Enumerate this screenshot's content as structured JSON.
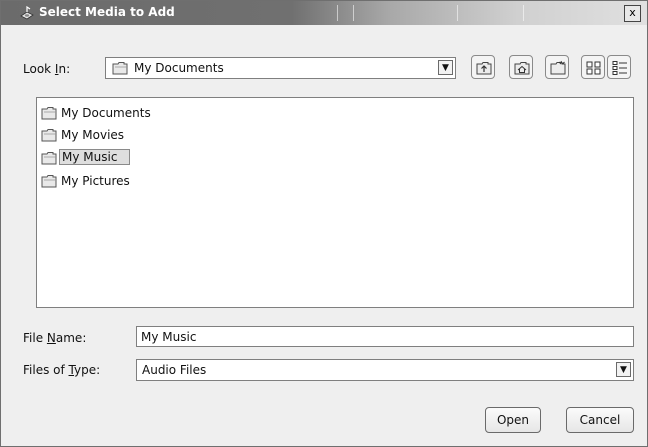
{
  "window": {
    "title": "Select Media to Add",
    "close_label": "x"
  },
  "look_in": {
    "label_prefix": "Look ",
    "label_mnemonic": "I",
    "label_suffix": "n:",
    "value": "My Documents"
  },
  "toolbar": {
    "buttons": [
      {
        "name": "up-one-level",
        "icon": "folder-up-icon"
      },
      {
        "name": "home",
        "icon": "home-icon"
      },
      {
        "name": "new-folder",
        "icon": "new-folder-icon"
      },
      {
        "name": "list-view",
        "icon": "list-view-icon"
      },
      {
        "name": "details-view",
        "icon": "details-view-icon"
      }
    ]
  },
  "files": [
    {
      "label": "My Documents",
      "selected": false
    },
    {
      "label": "My Movies",
      "selected": false
    },
    {
      "label": "My Music",
      "selected": true
    },
    {
      "label": "My Pictures",
      "selected": false
    }
  ],
  "file_name": {
    "label_prefix": "File ",
    "label_mnemonic": "N",
    "label_suffix": "ame:",
    "value": "My Music"
  },
  "file_type": {
    "label_prefix": "Files of ",
    "label_mnemonic": "T",
    "label_suffix": "ype:",
    "value": "Audio Files"
  },
  "buttons": {
    "open": "Open",
    "cancel": "Cancel"
  }
}
